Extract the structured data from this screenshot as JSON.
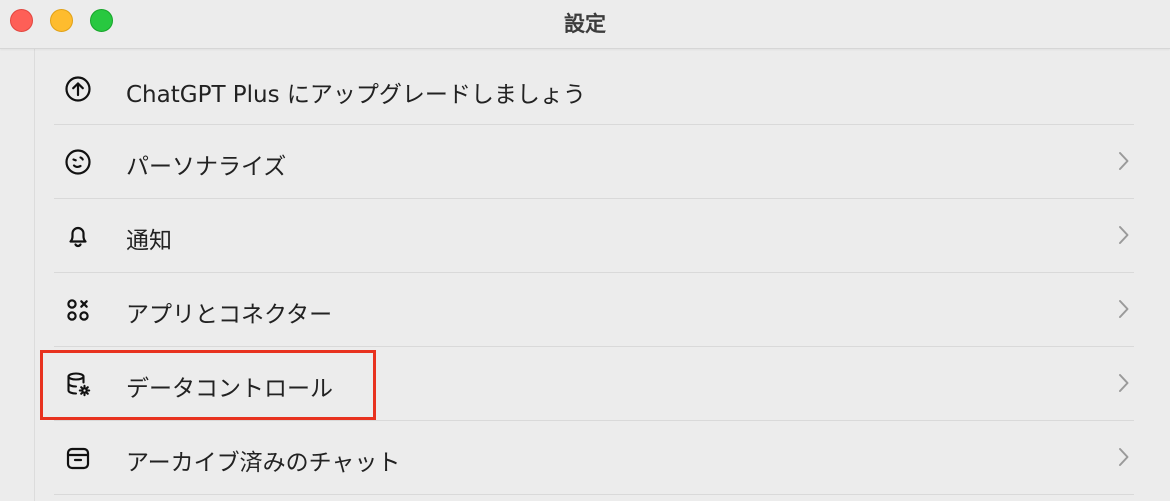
{
  "window": {
    "title": "設定"
  },
  "settings": {
    "items": [
      {
        "label": "ChatGPT Plus にアップグレードしましょう",
        "icon": "upgrade-arrow-icon",
        "chevron": false
      },
      {
        "label": "パーソナライズ",
        "icon": "personalize-face-icon",
        "chevron": true
      },
      {
        "label": "通知",
        "icon": "bell-icon",
        "chevron": true
      },
      {
        "label": "アプリとコネクター",
        "icon": "apps-connectors-icon",
        "chevron": true
      },
      {
        "label": "データコントロール",
        "icon": "database-gear-icon",
        "chevron": true,
        "highlighted": true
      },
      {
        "label": "アーカイブ済みのチャット",
        "icon": "archive-box-icon",
        "chevron": true
      }
    ]
  },
  "colors": {
    "highlight_border": "#e8321f",
    "traffic_close": "#fe5f57",
    "traffic_minimize": "#febc2e",
    "traffic_maximize": "#28c840"
  }
}
